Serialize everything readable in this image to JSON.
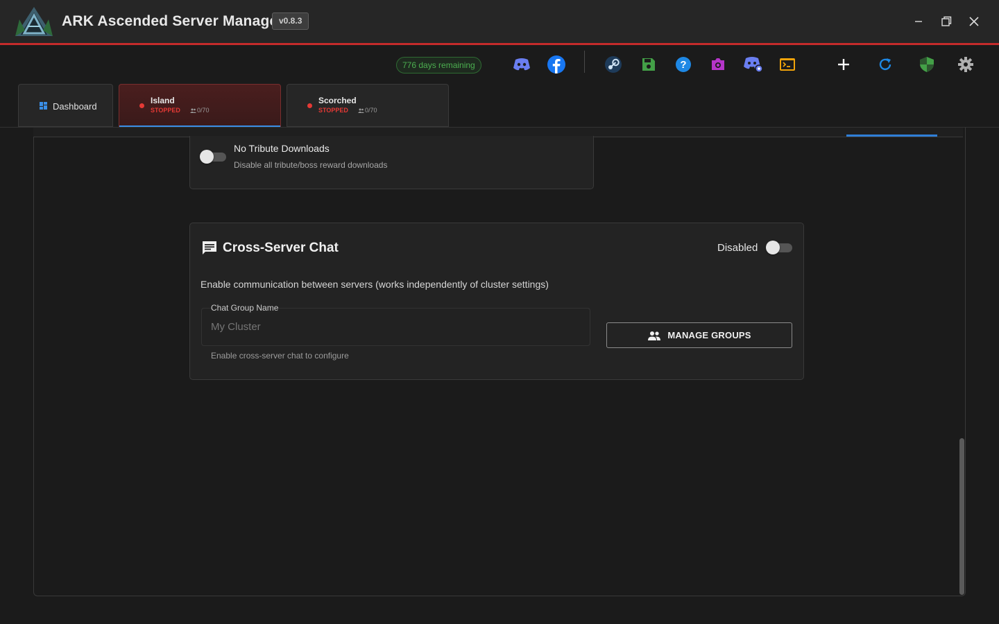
{
  "app": {
    "title": "ARK Ascended Server Manager",
    "version": "v0.8.3"
  },
  "toolbar": {
    "license_badge": "776 days remaining",
    "icons": [
      "discord-icon",
      "facebook-icon",
      "steam-icon",
      "save-icon",
      "help-icon",
      "camera-icon",
      "discord-bot-icon",
      "terminal-icon",
      "add-icon",
      "refresh-icon",
      "shield-icon",
      "settings-icon"
    ]
  },
  "tabs": [
    {
      "label": "Dashboard"
    },
    {
      "label": "Island",
      "status": "STOPPED",
      "players": "0/70",
      "active": true
    },
    {
      "label": "Scorched",
      "status": "STOPPED",
      "players": "0/70"
    }
  ],
  "options": {
    "no_tribute": {
      "title": "No Tribute Downloads",
      "description": "Disable all tribute/boss reward downloads"
    }
  },
  "cross_server_chat": {
    "title": "Cross-Server Chat",
    "status_label": "Disabled",
    "description": "Enable communication between servers (works independently of cluster settings)",
    "field_label": "Chat Group Name",
    "field_placeholder": "My Cluster",
    "field_helper": "Enable cross-server chat to configure",
    "manage_button": "MANAGE GROUPS"
  },
  "colors": {
    "accent_red": "#c42b2b",
    "accent_blue": "#2f7fd8",
    "status_stopped": "#e53935",
    "license_green": "#4caf50"
  }
}
